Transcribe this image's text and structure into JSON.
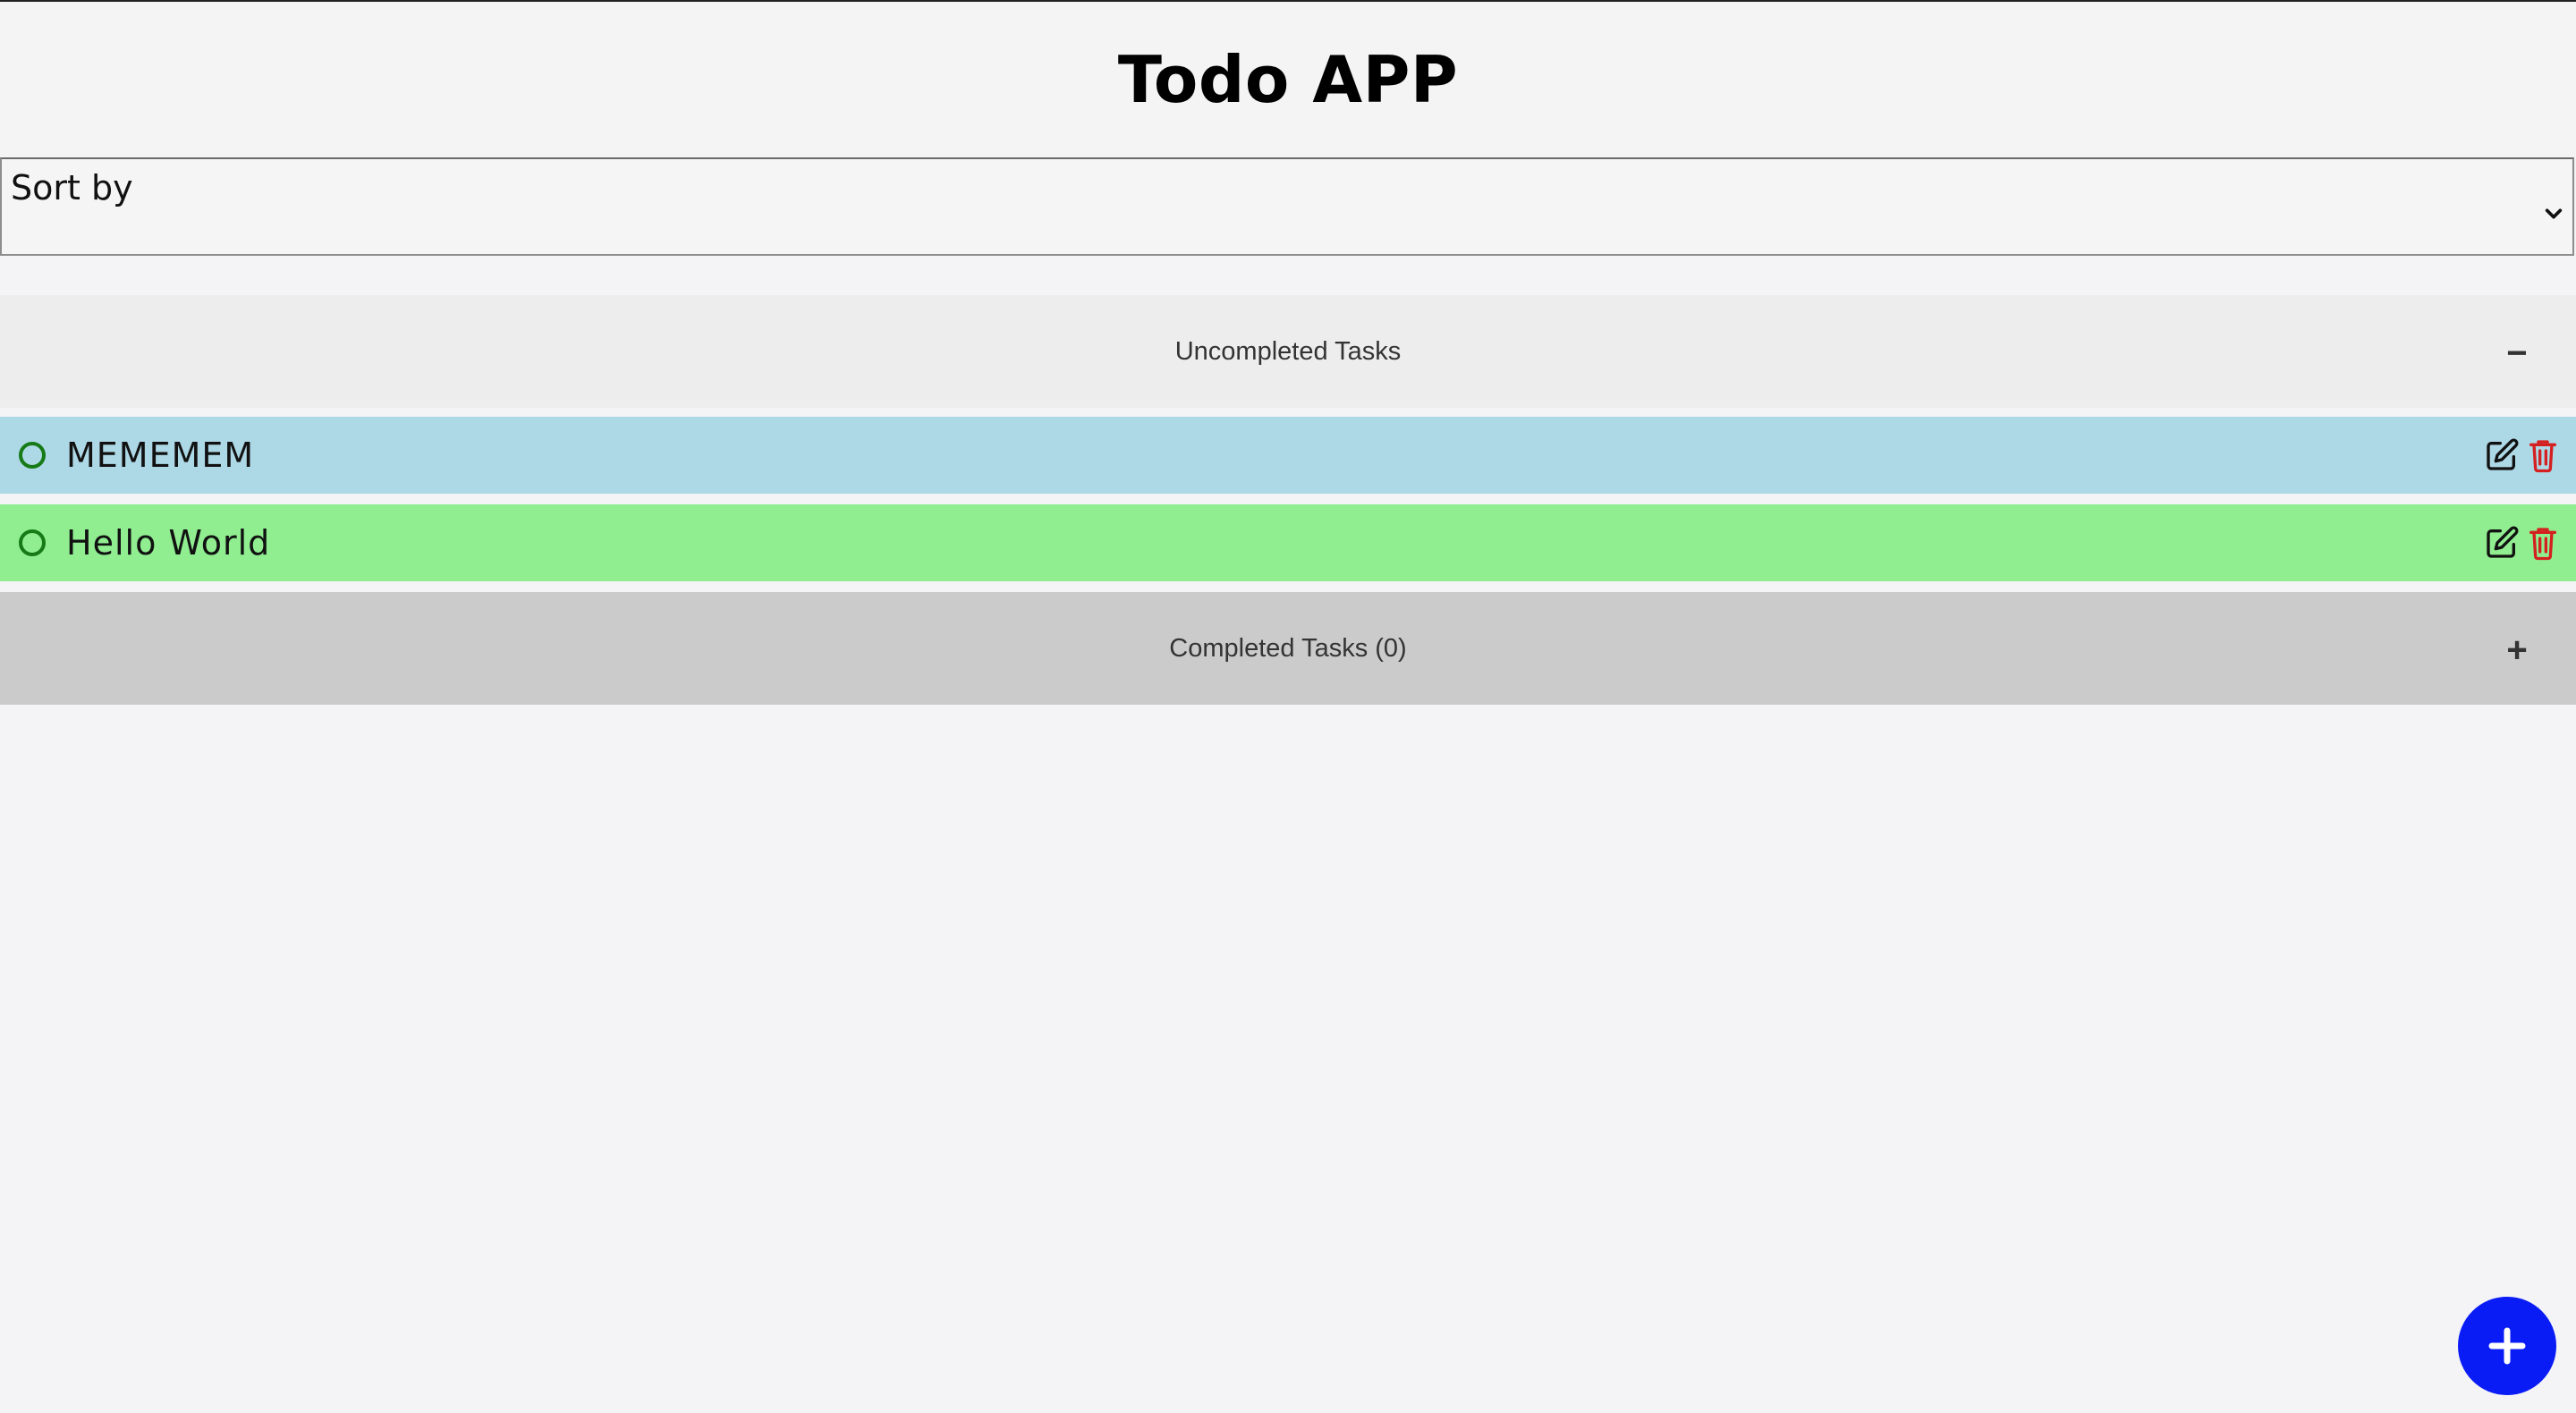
{
  "app": {
    "title": "Todo APP"
  },
  "sort": {
    "label": "Sort by"
  },
  "sections": {
    "uncompleted": {
      "label": "Uncompleted Tasks",
      "toggle": "−"
    },
    "completed": {
      "label": "Completed Tasks (0)",
      "toggle": "+"
    }
  },
  "tasks": [
    {
      "text": "MEMEMEM",
      "color": "#add8e6"
    },
    {
      "text": "Hello World",
      "color": "#90ee90"
    }
  ],
  "icons": {
    "status": "circle-outline-icon",
    "edit": "edit-icon",
    "delete": "trash-icon",
    "add": "plus-icon",
    "dropdown": "chevron-down-icon"
  },
  "colors": {
    "background": "#f4f4f6",
    "status_circle": "#167a16",
    "delete_icon": "#d42020",
    "fab": "#0a1cf5",
    "completed_header": "#cbcbcb",
    "uncompleted_header": "#ededed"
  }
}
